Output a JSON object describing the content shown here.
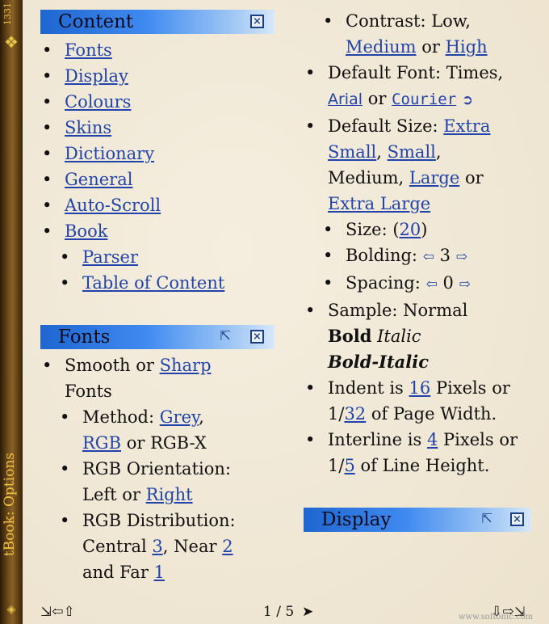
{
  "spine": {
    "title": "tBook: Options",
    "number": "1331"
  },
  "content_panel": {
    "title": "Content",
    "items": [
      "Fonts",
      "Display",
      "Colours",
      "Skins",
      "Dictionary",
      "General",
      "Auto-Scroll",
      "Book"
    ],
    "sub_items": [
      "Parser",
      "Table of Content"
    ]
  },
  "fonts_panel": {
    "title": "Fonts",
    "smooth": "Smooth or",
    "sharp": "Sharp",
    "fonts_word": "Fonts",
    "method_label": "Method:",
    "grey": "Grey",
    "rgb": "RGB",
    "or_rgbx": "or RGB-X",
    "orientation": "RGB Orientation:",
    "left_or": "Left or",
    "right": "Right",
    "distribution": "RGB Distribution:",
    "central": "Central",
    "central_val": "3",
    "near": "Near",
    "near_val": "2",
    "and_far": "and Far",
    "far_val": "1"
  },
  "right_col": {
    "contrast": "Contrast: Low,",
    "medium": "Medium",
    "or": "or",
    "high": "High",
    "default_font": "Default Font: Times,",
    "arial": "Arial",
    "courier": "Courier",
    "default_size": "Default Size:",
    "extra_small": "Extra Small",
    "small": "Small",
    "medium_size": "Medium,",
    "large": "Large",
    "extra_large": "Extra Large",
    "size_label": "Size: (",
    "size_val": "20",
    "size_close": ")",
    "bolding_label": "Bolding:",
    "bolding_val": "3",
    "spacing_label": "Spacing:",
    "spacing_val": "0",
    "sample_label": "Sample: Normal",
    "bold": "Bold",
    "italic": "Italic",
    "bold_italic": "Bold-Italic",
    "indent_pre": "Indent is",
    "indent_val": "16",
    "indent_mid": "Pixels or 1/",
    "indent_frac": "32",
    "indent_post": "of Page Width.",
    "interline_pre": "Interline is",
    "interline_val": "4",
    "interline_mid": "Pixels or 1/",
    "interline_frac": "5",
    "interline_post": "of Line Height.",
    "display_title": "Display"
  },
  "footer": {
    "page": "1 / 5",
    "watermark": "www.softonic.com"
  }
}
